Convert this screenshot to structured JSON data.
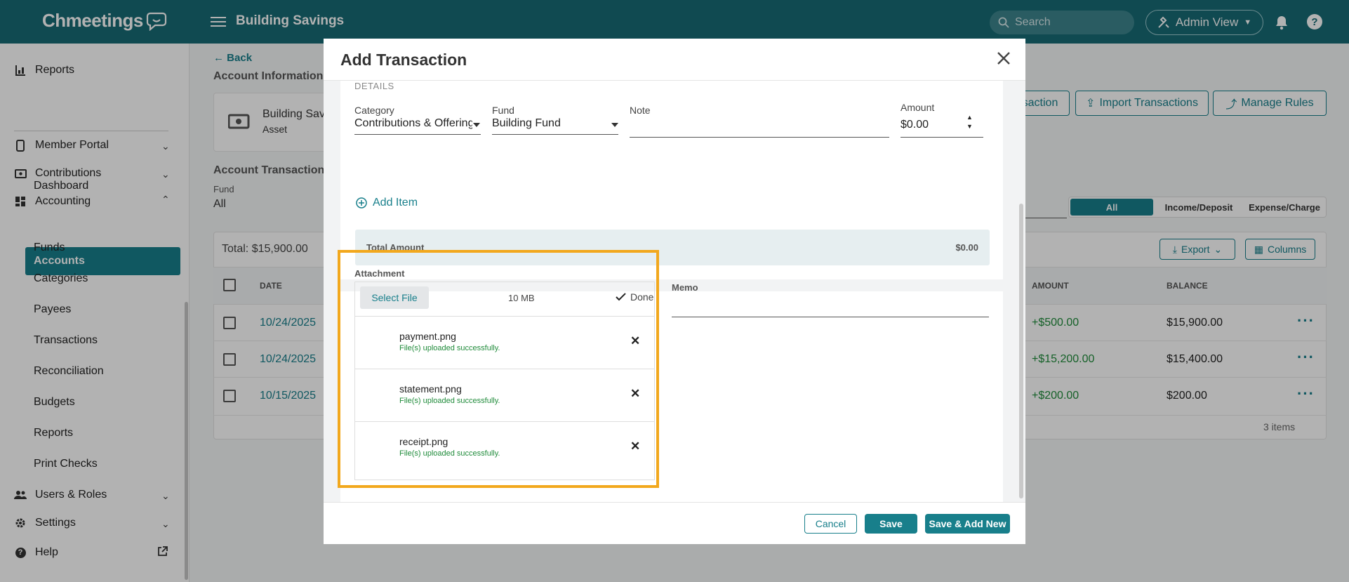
{
  "app": {
    "logo_text": "Chmeetings",
    "page_title": "Building Savings"
  },
  "topbar": {
    "search_placeholder": "Search",
    "admin_view_label": "Admin View"
  },
  "sidebar": {
    "items": [
      {
        "label": "Reports"
      },
      {
        "label": "Member Portal"
      },
      {
        "label": "Contributions"
      },
      {
        "label": "Accounting"
      },
      {
        "label": "Users & Roles"
      },
      {
        "label": "Settings"
      },
      {
        "label": "Help"
      }
    ],
    "accounting_sub": [
      "Dashboard",
      "Accounts",
      "Funds",
      "Categories",
      "Payees",
      "Transactions",
      "Reconciliation",
      "Budgets",
      "Reports",
      "Print Checks"
    ]
  },
  "page": {
    "back_label": "Back",
    "account_info_heading": "Account Information",
    "account_name": "Building Sav",
    "account_type": "Asset",
    "transactions_heading": "Account Transaction",
    "fund_label": "Fund",
    "fund_value": "All",
    "add_txn_label": "saction",
    "import_label": "Import Transactions",
    "manage_rules_label": "Manage Rules",
    "segments": [
      "All",
      "Income/Deposit",
      "Expense/Charge"
    ],
    "total_label": "Total:",
    "total_value": "$15,900.00",
    "export_label": "Export",
    "columns_label": "Columns",
    "columns": {
      "date": "DATE",
      "amount": "AMOUNT",
      "balance": "BALANCE"
    },
    "rows": [
      {
        "date": "10/24/2025",
        "amount": "+$500.00",
        "balance": "$15,900.00"
      },
      {
        "date": "10/24/2025",
        "amount": "+$15,200.00",
        "balance": "$15,400.00"
      },
      {
        "date": "10/15/2025",
        "amount": "+$200.00",
        "balance": "$200.00"
      }
    ],
    "items_count": "3 items"
  },
  "modal": {
    "title": "Add Transaction",
    "details_heading": "DETAILS",
    "category_label": "Category",
    "category_value": "Contributions & Offerings",
    "fund_label": "Fund",
    "fund_value": "Building Fund",
    "note_label": "Note",
    "note_value": "",
    "amount_label": "Amount",
    "amount_value": "$0.00",
    "add_item_label": "Add Item",
    "total_amount_label": "Total Amount",
    "total_amount_value": "$0.00",
    "attachment_label": "Attachment",
    "select_file_label": "Select File",
    "max_size": "10 MB",
    "done_label": "Done",
    "attachments": [
      {
        "name": "payment.png",
        "status": "File(s) uploaded successfully."
      },
      {
        "name": "statement.png",
        "status": "File(s) uploaded successfully."
      },
      {
        "name": "receipt.png",
        "status": "File(s) uploaded successfully."
      }
    ],
    "memo_label": "Memo",
    "cancel_label": "Cancel",
    "save_label": "Save",
    "save_add_new_label": "Save & Add New"
  },
  "colors": {
    "brand": "#186a74",
    "accent": "#187f8b",
    "success": "#1f8b3a",
    "highlight": "#f2a81d"
  }
}
